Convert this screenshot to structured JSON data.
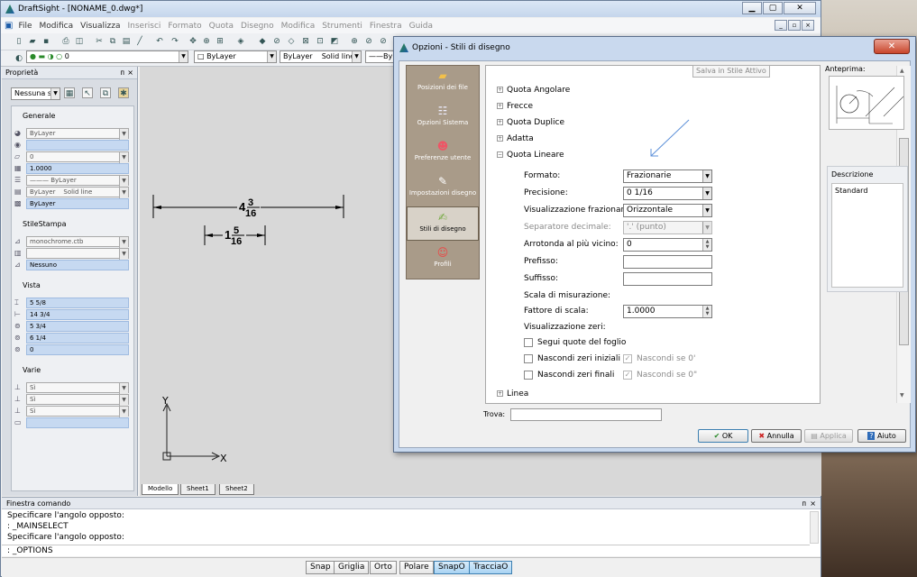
{
  "app": {
    "title": "DraftSight - [NONAME_0.dwg*]",
    "menus": [
      "File",
      "Modifica",
      "Visualizza",
      "Inserisci",
      "Formato",
      "Quota",
      "Disegno",
      "Modifica",
      "Strumenti",
      "Finestra",
      "Guida"
    ]
  },
  "toolbar2": {
    "layer_value": "0",
    "color_value": "ByLayer",
    "linetype_value": "ByLayer",
    "linetype_name": "Solid line",
    "lineweight_value": "ByL"
  },
  "properties": {
    "title": "Proprietà",
    "selector": "Nessuna sel",
    "generale": {
      "label": "Generale",
      "rows": [
        "ByLayer",
        "",
        "0",
        "1.0000",
        "ByLayer",
        "ByLayer",
        "Solid line",
        "ByLayer"
      ]
    },
    "stilestampa": {
      "label": "StileStampa",
      "rows": [
        "monochrome.ctb",
        "",
        "Nessuno"
      ]
    },
    "vista": {
      "label": "Vista",
      "rows": [
        "5 5/8",
        "14 3/4",
        "5 3/4",
        "6 1/4",
        "0"
      ]
    },
    "varie": {
      "label": "Varie",
      "rows": [
        "Sì",
        "Sì",
        "Sì",
        ""
      ]
    }
  },
  "drawing": {
    "dim1": {
      "whole": "4",
      "num": "3",
      "den": "16"
    },
    "dim2": {
      "whole": "1",
      "num": "5",
      "den": "16"
    },
    "axis_x": "X",
    "axis_y": "Y",
    "tabs": [
      "Modello",
      "Sheet1",
      "Sheet2"
    ]
  },
  "command": {
    "title": "Finestra comando",
    "lines": [
      "Specificare l'angolo opposto:",
      ": _MAINSELECT",
      "Specificare l'angolo opposto:"
    ],
    "prompt": ": _OPTIONS"
  },
  "status": {
    "buttons": [
      {
        "label": "Snap"
      },
      {
        "label": "Griglia"
      },
      {
        "label": "Orto"
      },
      {
        "label": "Polare"
      },
      {
        "label": "SnapO"
      },
      {
        "label": "TracciaO"
      }
    ]
  },
  "dialog": {
    "title": "Opzioni - Stili di disegno",
    "nav": [
      "Posizioni dei file",
      "Opzioni Sistema",
      "Preferenze utente",
      "Impostazioni disegno",
      "Stili di disegno",
      "Profili"
    ],
    "save_label": "Salva in Stile Attivo",
    "tree": {
      "quota_angolare": "Quota Angolare",
      "frecce": "Frecce",
      "quota_duplice": "Quota Duplice",
      "adatta": "Adatta",
      "quota_lineare": "Quota Lineare",
      "linea": "Linea"
    },
    "fields": {
      "formato_label": "Formato:",
      "formato_value": "Frazionarie",
      "precisione_label": "Precisione:",
      "precisione_value": "0 1/16",
      "visfraz_label": "Visualizzazione frazionaria:",
      "visfraz_value": "Orizzontale",
      "sepdec_label": "Separatore decimale:",
      "sepdec_value": "'.' (punto)",
      "arrotonda_label": "Arrotonda al più vicino:",
      "arrotonda_value": "0",
      "prefisso_label": "Prefisso:",
      "prefisso_value": "",
      "suffisso_label": "Suffisso:",
      "suffisso_value": "",
      "scala_label": "Scala di misurazione:",
      "fattore_label": "Fattore di scala:",
      "fattore_value": "1.0000",
      "viszeri_label": "Visualizzazione zeri:",
      "segui_label": "Segui quote del foglio",
      "nascondi_iniziali_label": "Nascondi zeri iniziali",
      "nascondi_finali_label": "Nascondi zeri finali",
      "nascondi_se_0_label": "Nascondi se 0'",
      "nascondi_se_0b_label": "Nascondi se 0\""
    },
    "preview_label": "Anteprima:",
    "description_label": "Descrizione",
    "description_value": "Standard",
    "find_label": "Trova:",
    "buttons": {
      "ok": "OK",
      "cancel": "Annulla",
      "apply": "Applica",
      "help": "Aiuto"
    }
  }
}
